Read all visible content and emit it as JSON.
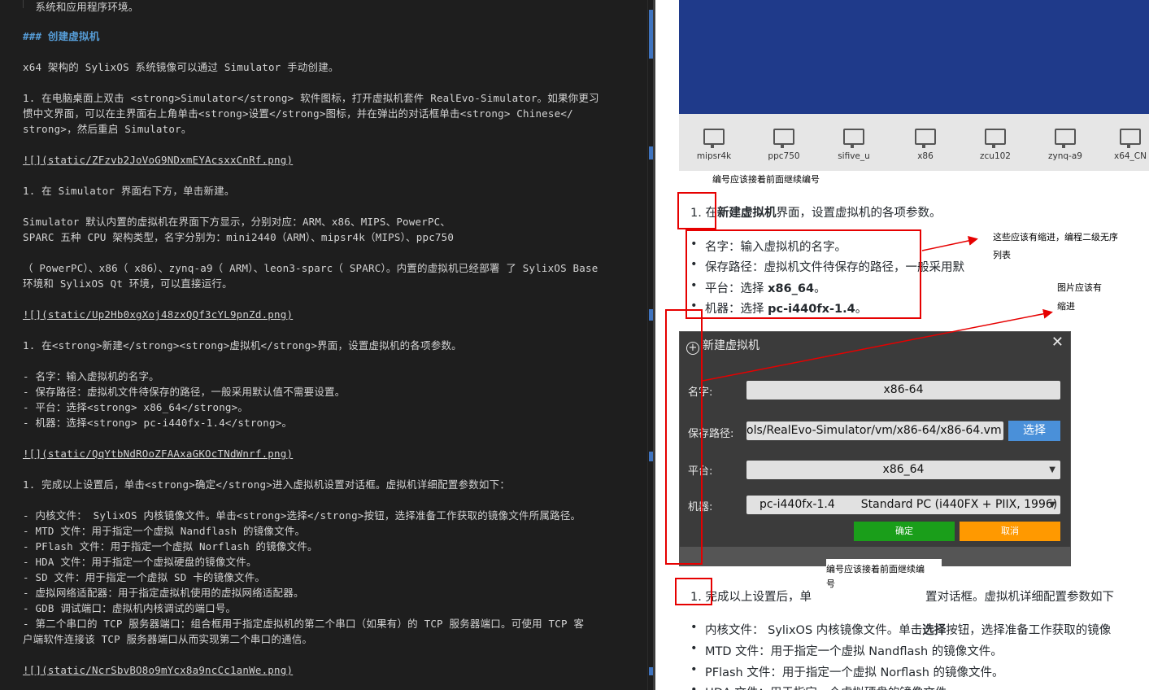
{
  "editor": {
    "lines": [
      "  系统和应用程序环境。",
      "### 创建虚拟机",
      "x64 架构的 SylixOS 系统镜像可以通过 Simulator 手动创建。",
      "1. 在电脑桌面上双击 <strong>Simulator</strong> 软件图标，打开虚拟机套件 RealEvo-Simulator。如果你更习",
      "惯中文界面，可以在主界面右上角单击<strong>设置</strong>图标，并在弹出的对话框单击<strong> Chinese</",
      "strong>，然后重启 Simulator。",
      "![](static/ZFzvb2JoVoG9NDxmEYAcsxxCnRf.png)",
      "1. 在 Simulator 界面右下方，单击新建。",
      "Simulator 默认内置的虚拟机在界面下方显示，分别对应：ARM、x86、MIPS、PowerPC、",
      "SPARC 五种 CPU 架构类型，名字分别为：mini2440（ARM）、mipsr4k（MIPS）、ppc750",
      "（ PowerPC）、x86（ x86）、zynq-a9（ ARM）、leon3-sparc（ SPARC）。内置的虚拟机已经部署 了 SylixOS Base",
      "环境和 SylixOS Qt 环境，可以直接运行。",
      "![](static/Up2Hb0xgXoj48zxQQf3cYL9pnZd.png)",
      "1. 在<strong>新建</strong><strong>虚拟机</strong>界面，设置虚拟机的各项参数。",
      "- 名字：输入虚拟机的名字。",
      "- 保存路径：虚拟机文件待保存的路径，一般采用默认值不需要设置。",
      "- 平台：选择<strong> x86_64</strong>。",
      "- 机器：选择<strong> pc-i440fx-1.4</strong>。",
      "![](static/QqYtbNdROoZFAAxaGKOcTNdWnrf.png)",
      "1. 完成以上设置后，单击<strong>确定</strong>进入虚拟机设置对话框。虚拟机详细配置参数如下：",
      "- 内核文件： SylixOS 内核镜像文件。单击<strong>选择</strong>按钮，选择准备工作获取的镜像文件所属路径。",
      "- MTD 文件：用于指定一个虚拟 Nandflash 的镜像文件。",
      "- PFlash 文件：用于指定一个虚拟 Norflash 的镜像文件。",
      "- HDA 文件：用于指定一个虚拟硬盘的镜像文件。",
      "- SD 文件：用于指定一个虚拟 SD 卡的镜像文件。",
      "- 虚拟网络适配器：用于指定虚拟机使用的虚拟网络适配器。",
      "- GDB 调试端口：虚拟机内核调试的端口号。",
      "- 第二个串口的 TCP 服务器端口：组合框用于指定虚拟机的第二个串口（如果有）的 TCP 服务器端口。可使用 TCP 客",
      "户端软件连接该 TCP 服务器端口从而实现第二个串口的通信。",
      "![](static/NcrSbvBO8o9mYcx8a9ncCc1anWe.png)"
    ]
  },
  "preview": {
    "vm_list": [
      "mipsr4k",
      "ppc750",
      "sifive_u",
      "x86",
      "zcu102",
      "zynq-a9",
      "x64_CN"
    ],
    "note_numbering_1": "编号应该接着前面继续编号",
    "step_new_vm": {
      "num": "1. 在",
      "bold": "新建虚拟机",
      "rest": "界面，设置虚拟机的各项参数。"
    },
    "bullets_1": [
      {
        "label": "名字：输入虚拟机的名字。",
        "bold": ""
      },
      {
        "label": "保存路径：虚拟机文件待保存的路径，一般采用默",
        "bold": ""
      },
      {
        "label": "平台：选择 ",
        "bold": "x86_64",
        "tail": "。"
      },
      {
        "label": "机器：选择 ",
        "bold": "pc-i440fx-1.4",
        "tail": "。"
      }
    ],
    "note_indent_1": "这些应该有缩进，编程二级无序",
    "note_indent_1b": "列表",
    "note_image_1": "图片应该有",
    "note_image_1b": "缩进",
    "dialog": {
      "title": "新建虚拟机",
      "close": "✕",
      "label_name": "名字:",
      "value_name": "x86-64",
      "label_path": "保存路径:",
      "value_path": "ols/RealEvo-Simulator/vm/x86-64/x86-64.vm",
      "choose": "选择",
      "label_platform": "平台:",
      "value_platform": "x86_64",
      "label_machine": "机器:",
      "value_machine_a": "pc-i440fx-1.4",
      "value_machine_b": "Standard PC (i440FX + PIIX, 1996)",
      "ok": "确定",
      "cancel": "取消"
    },
    "note_numbering_2": "编号应该接着前面继续编",
    "note_numbering_2b": "号",
    "step_done": {
      "num": "1. 完成以上设置后，单",
      "rest": "置对话框。虚拟机详细配置参数如下"
    },
    "bullets_2": [
      {
        "pre": "内核文件： SylixOS 内核镜像文件。单击",
        "bold": "选择",
        "post": "按钮，选择准备工作获取的镜像"
      },
      {
        "pre": "MTD 文件：用于指定一个虚拟 Nandflash 的镜像文件。",
        "bold": "",
        "post": ""
      },
      {
        "pre": "PFlash 文件：用于指定一个虚拟 Norflash 的镜像文件。",
        "bold": "",
        "post": ""
      },
      {
        "pre": "HDA 文件：用于指定一个虚拟硬盘的镜像文件。",
        "bold": "",
        "post": ""
      }
    ]
  }
}
